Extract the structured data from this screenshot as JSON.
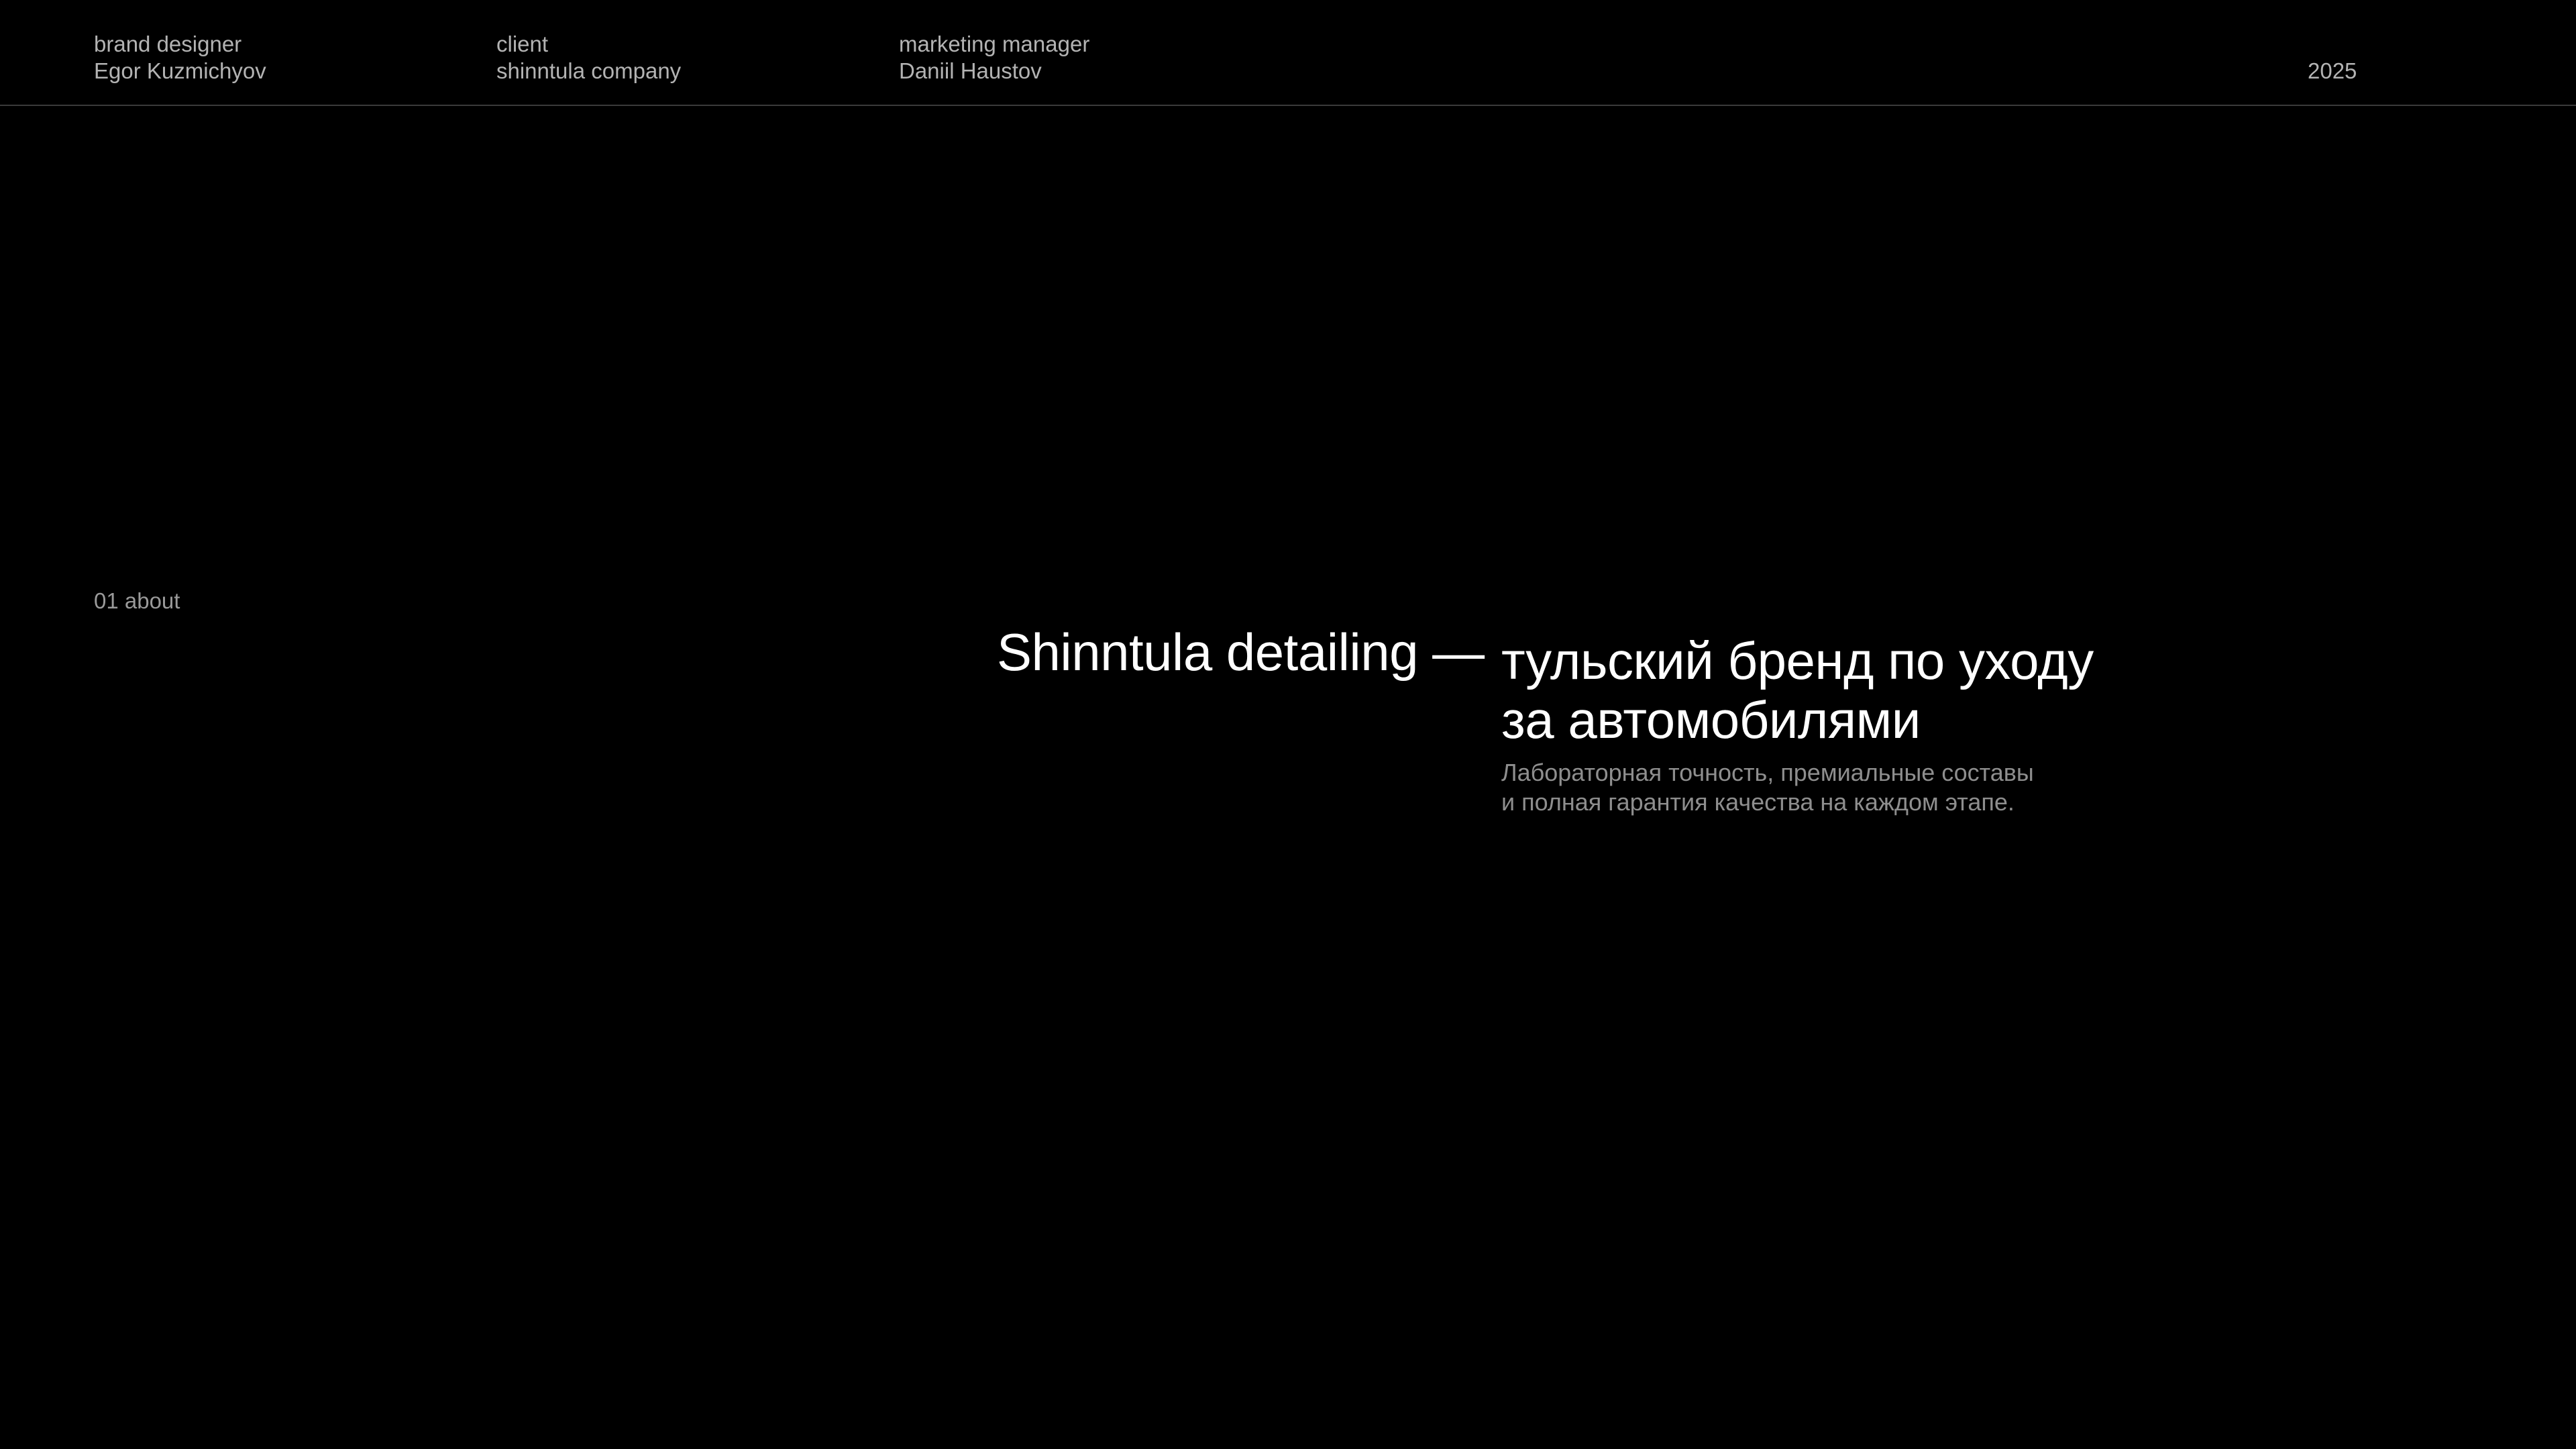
{
  "header": {
    "designer": {
      "role": "brand designer",
      "name": "Egor Kuzmichyov"
    },
    "client": {
      "role": "client",
      "name": "shinntula company"
    },
    "manager": {
      "role": "marketing manager",
      "name": "Daniil Haustov"
    },
    "year": "2025"
  },
  "section": {
    "label": "01 about"
  },
  "hero": {
    "brand": "Shinntula detailing —",
    "tagline_line1": "тульский бренд по уходу",
    "tagline_line2": "за автомобилями",
    "description_line1": "Лабораторная точность, премиальные составы",
    "description_line2": "и полная гарантия качества на каждом этапе."
  },
  "colors": {
    "background": "#000000",
    "primary_text": "#ffffff",
    "secondary_text": "#b3b3b3",
    "divider": "#3a3a3a"
  }
}
